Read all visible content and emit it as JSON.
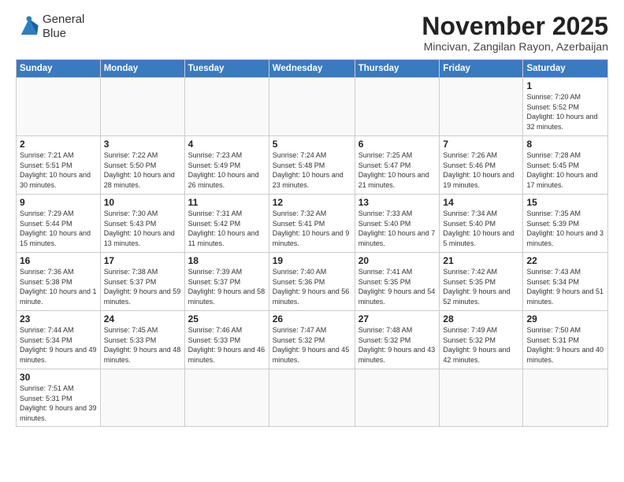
{
  "logo": {
    "line1": "General",
    "line2": "Blue"
  },
  "title": "November 2025",
  "subtitle": "Mincivan, Zangilan Rayon, Azerbaijan",
  "days_of_week": [
    "Sunday",
    "Monday",
    "Tuesday",
    "Wednesday",
    "Thursday",
    "Friday",
    "Saturday"
  ],
  "weeks": [
    [
      {
        "day": "",
        "info": ""
      },
      {
        "day": "",
        "info": ""
      },
      {
        "day": "",
        "info": ""
      },
      {
        "day": "",
        "info": ""
      },
      {
        "day": "",
        "info": ""
      },
      {
        "day": "",
        "info": ""
      },
      {
        "day": "1",
        "info": "Sunrise: 7:20 AM\nSunset: 5:52 PM\nDaylight: 10 hours\nand 32 minutes."
      }
    ],
    [
      {
        "day": "2",
        "info": "Sunrise: 7:21 AM\nSunset: 5:51 PM\nDaylight: 10 hours\nand 30 minutes."
      },
      {
        "day": "3",
        "info": "Sunrise: 7:22 AM\nSunset: 5:50 PM\nDaylight: 10 hours\nand 28 minutes."
      },
      {
        "day": "4",
        "info": "Sunrise: 7:23 AM\nSunset: 5:49 PM\nDaylight: 10 hours\nand 26 minutes."
      },
      {
        "day": "5",
        "info": "Sunrise: 7:24 AM\nSunset: 5:48 PM\nDaylight: 10 hours\nand 23 minutes."
      },
      {
        "day": "6",
        "info": "Sunrise: 7:25 AM\nSunset: 5:47 PM\nDaylight: 10 hours\nand 21 minutes."
      },
      {
        "day": "7",
        "info": "Sunrise: 7:26 AM\nSunset: 5:46 PM\nDaylight: 10 hours\nand 19 minutes."
      },
      {
        "day": "8",
        "info": "Sunrise: 7:28 AM\nSunset: 5:45 PM\nDaylight: 10 hours\nand 17 minutes."
      }
    ],
    [
      {
        "day": "9",
        "info": "Sunrise: 7:29 AM\nSunset: 5:44 PM\nDaylight: 10 hours\nand 15 minutes."
      },
      {
        "day": "10",
        "info": "Sunrise: 7:30 AM\nSunset: 5:43 PM\nDaylight: 10 hours\nand 13 minutes."
      },
      {
        "day": "11",
        "info": "Sunrise: 7:31 AM\nSunset: 5:42 PM\nDaylight: 10 hours\nand 11 minutes."
      },
      {
        "day": "12",
        "info": "Sunrise: 7:32 AM\nSunset: 5:41 PM\nDaylight: 10 hours\nand 9 minutes."
      },
      {
        "day": "13",
        "info": "Sunrise: 7:33 AM\nSunset: 5:40 PM\nDaylight: 10 hours\nand 7 minutes."
      },
      {
        "day": "14",
        "info": "Sunrise: 7:34 AM\nSunset: 5:40 PM\nDaylight: 10 hours\nand 5 minutes."
      },
      {
        "day": "15",
        "info": "Sunrise: 7:35 AM\nSunset: 5:39 PM\nDaylight: 10 hours\nand 3 minutes."
      }
    ],
    [
      {
        "day": "16",
        "info": "Sunrise: 7:36 AM\nSunset: 5:38 PM\nDaylight: 10 hours\nand 1 minute."
      },
      {
        "day": "17",
        "info": "Sunrise: 7:38 AM\nSunset: 5:37 PM\nDaylight: 9 hours\nand 59 minutes."
      },
      {
        "day": "18",
        "info": "Sunrise: 7:39 AM\nSunset: 5:37 PM\nDaylight: 9 hours\nand 58 minutes."
      },
      {
        "day": "19",
        "info": "Sunrise: 7:40 AM\nSunset: 5:36 PM\nDaylight: 9 hours\nand 56 minutes."
      },
      {
        "day": "20",
        "info": "Sunrise: 7:41 AM\nSunset: 5:35 PM\nDaylight: 9 hours\nand 54 minutes."
      },
      {
        "day": "21",
        "info": "Sunrise: 7:42 AM\nSunset: 5:35 PM\nDaylight: 9 hours\nand 52 minutes."
      },
      {
        "day": "22",
        "info": "Sunrise: 7:43 AM\nSunset: 5:34 PM\nDaylight: 9 hours\nand 51 minutes."
      }
    ],
    [
      {
        "day": "23",
        "info": "Sunrise: 7:44 AM\nSunset: 5:34 PM\nDaylight: 9 hours\nand 49 minutes."
      },
      {
        "day": "24",
        "info": "Sunrise: 7:45 AM\nSunset: 5:33 PM\nDaylight: 9 hours\nand 48 minutes."
      },
      {
        "day": "25",
        "info": "Sunrise: 7:46 AM\nSunset: 5:33 PM\nDaylight: 9 hours\nand 46 minutes."
      },
      {
        "day": "26",
        "info": "Sunrise: 7:47 AM\nSunset: 5:32 PM\nDaylight: 9 hours\nand 45 minutes."
      },
      {
        "day": "27",
        "info": "Sunrise: 7:48 AM\nSunset: 5:32 PM\nDaylight: 9 hours\nand 43 minutes."
      },
      {
        "day": "28",
        "info": "Sunrise: 7:49 AM\nSunset: 5:32 PM\nDaylight: 9 hours\nand 42 minutes."
      },
      {
        "day": "29",
        "info": "Sunrise: 7:50 AM\nSunset: 5:31 PM\nDaylight: 9 hours\nand 40 minutes."
      }
    ],
    [
      {
        "day": "30",
        "info": "Sunrise: 7:51 AM\nSunset: 5:31 PM\nDaylight: 9 hours\nand 39 minutes."
      },
      {
        "day": "",
        "info": ""
      },
      {
        "day": "",
        "info": ""
      },
      {
        "day": "",
        "info": ""
      },
      {
        "day": "",
        "info": ""
      },
      {
        "day": "",
        "info": ""
      },
      {
        "day": "",
        "info": ""
      }
    ]
  ]
}
